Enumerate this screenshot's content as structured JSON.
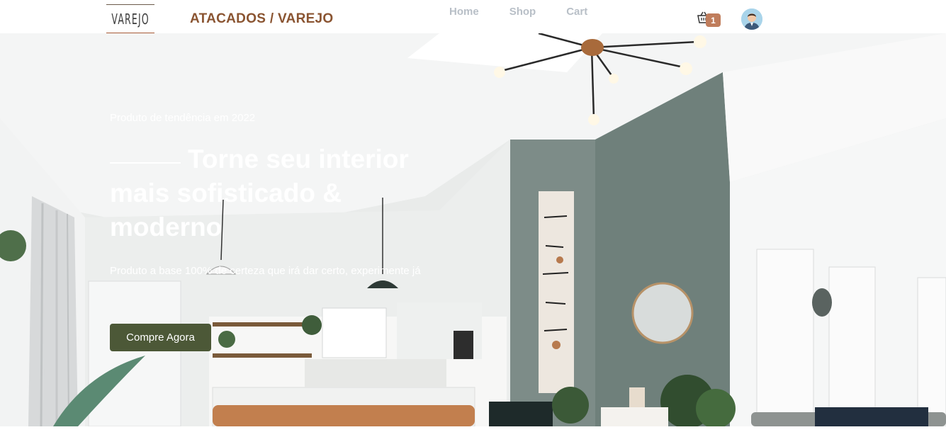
{
  "navbar": {
    "logo_text": "VAREJO",
    "brand_title": "ATACADOS / VAREJO",
    "links": [
      {
        "label": "Home"
      },
      {
        "label": "Shop"
      },
      {
        "label": "Cart"
      }
    ],
    "cart_icon": "basket-icon",
    "cart_count": "1",
    "avatar_icon": "user-avatar-icon"
  },
  "hero": {
    "eyebrow": "Produto de tendência em 2022",
    "headline": "Torne seu interior mais sofisticado & moderno",
    "subtext": "Produto a base 100% de certeza que irá dar certo, experimente já",
    "cta_label": "Compre Agora",
    "background": "living-room-interior-photo"
  },
  "colors": {
    "brand": "#8a5431",
    "nav_link": "#b8bfc7",
    "badge": "#c07d5c",
    "cta": "#4c5837"
  }
}
